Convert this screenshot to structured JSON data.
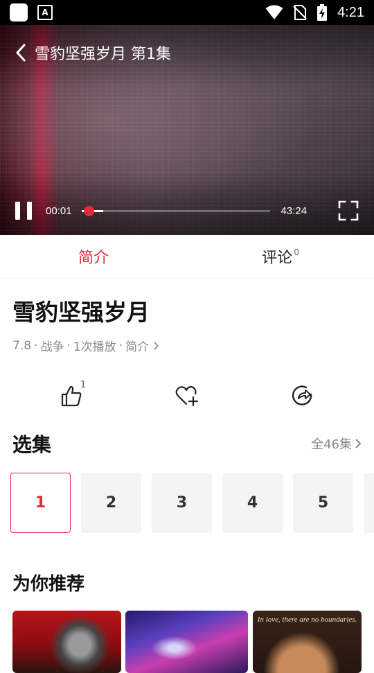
{
  "status_bar": {
    "time": "4:21",
    "app_icon_letter": "A"
  },
  "player": {
    "title": "雪豹坚强岁月 第1集",
    "current_time": "00:01",
    "total_time": "43:24",
    "progress_fraction": 0.02
  },
  "tabs": [
    {
      "label": "简介",
      "active": true
    },
    {
      "label": "评论",
      "count": "0",
      "active": false
    }
  ],
  "show": {
    "title": "雪豹坚强岁月",
    "rating": "7.8",
    "genre": "战争",
    "plays": "1次播放",
    "intro_link": "简介"
  },
  "actions": {
    "like_count": "1"
  },
  "episodes": {
    "title": "选集",
    "all_label": "全46集",
    "items": [
      "1",
      "2",
      "3",
      "4",
      "5"
    ],
    "selected": "1"
  },
  "recommend": {
    "title": "为你推荐",
    "poster3_tagline": "In love, there are no boundaries."
  },
  "colors": {
    "accent": "#e62a3c"
  }
}
